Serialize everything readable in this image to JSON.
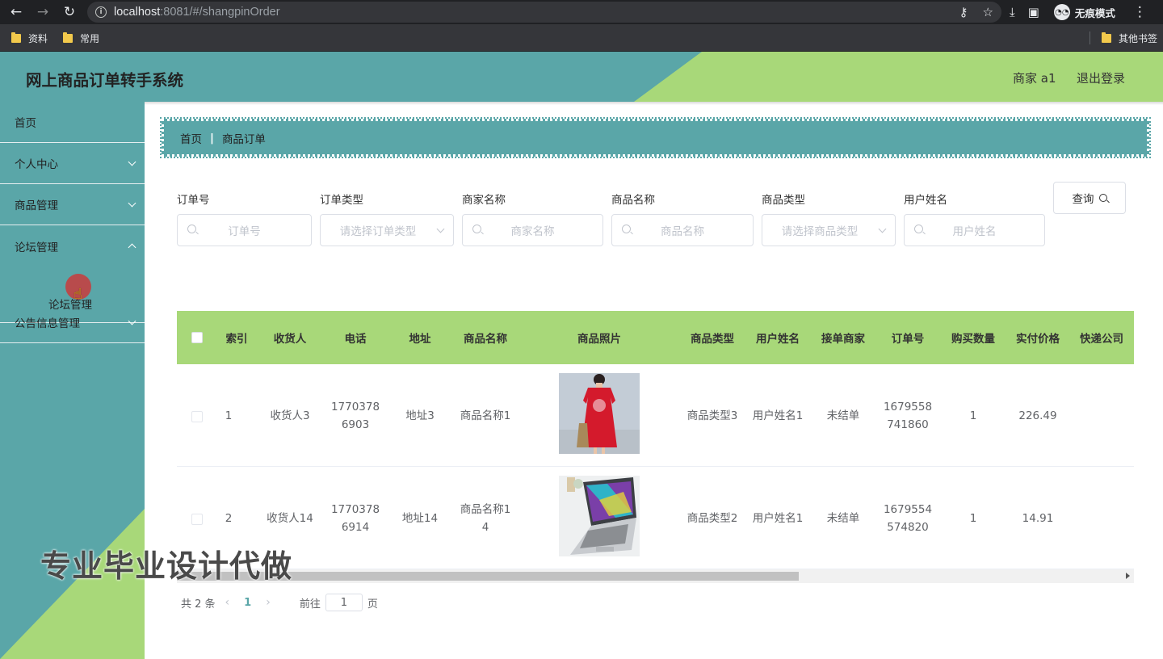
{
  "browser": {
    "url_host": "localhost",
    "url_rest": ":8081/#/shangpinOrder",
    "incognito_label": "无痕模式",
    "bookmarks": [
      "资料",
      "常用"
    ],
    "other_bookmarks": "其他书签"
  },
  "header": {
    "title": "网上商品订单转手系统",
    "user": "商家 a1",
    "logout": "退出登录"
  },
  "sidebar": {
    "items": [
      {
        "label": "首页"
      },
      {
        "label": "个人中心"
      },
      {
        "label": "商品管理"
      },
      {
        "label": "论坛管理"
      },
      {
        "label": "论坛管理"
      },
      {
        "label": "公告信息管理"
      }
    ]
  },
  "watermark": "专业毕业设计代做",
  "breadcrumb": {
    "home": "首页",
    "sep": "|",
    "current": "商品订单"
  },
  "search": {
    "fields": [
      {
        "label": "订单号",
        "placeholder": "订单号"
      },
      {
        "label": "订单类型",
        "placeholder": "请选择订单类型"
      },
      {
        "label": "商家名称",
        "placeholder": "商家名称"
      },
      {
        "label": "商品名称",
        "placeholder": "商品名称"
      },
      {
        "label": "商品类型",
        "placeholder": "请选择商品类型"
      },
      {
        "label": "用户姓名",
        "placeholder": "用户姓名"
      }
    ],
    "button": "查询"
  },
  "table": {
    "headers": [
      "索引",
      "收货人",
      "电话",
      "地址",
      "商品名称",
      "商品照片",
      "商品类型",
      "用户姓名",
      "接单商家",
      "订单号",
      "购买数量",
      "实付价格",
      "快递公司"
    ],
    "rows": [
      {
        "index": "1",
        "receiver": "收货人3",
        "phone": "17703786903",
        "address": "地址3",
        "product": "商品名称1",
        "photo": "red-dress",
        "type": "商品类型3",
        "username": "用户姓名1",
        "merchant": "未结单",
        "order_no": "1679558741860",
        "qty": "1",
        "price": "226.49",
        "courier": ""
      },
      {
        "index": "2",
        "receiver": "收货人14",
        "phone": "17703786914",
        "address": "地址14",
        "product": "商品名称14",
        "photo": "laptop",
        "type": "商品类型2",
        "username": "用户姓名1",
        "merchant": "未结单",
        "order_no": "1679554574820",
        "qty": "1",
        "price": "14.91",
        "courier": ""
      }
    ]
  },
  "pagination": {
    "total": "共 2 条",
    "current": "1",
    "goto": "前往",
    "page_input": "1",
    "page_unit": "页"
  },
  "colors": {
    "teal": "#5aa6a8",
    "green": "#a8d879"
  }
}
